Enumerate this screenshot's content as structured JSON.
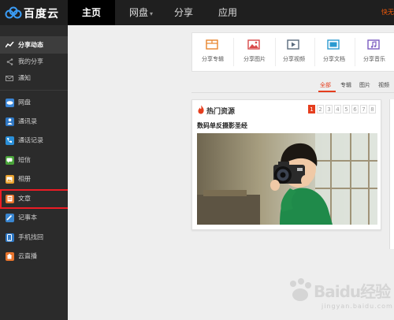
{
  "app": {
    "logo_text": "百度云"
  },
  "top_nav": {
    "items": [
      {
        "label": "主页",
        "active": true
      },
      {
        "label": "网盘"
      },
      {
        "label": "分享"
      },
      {
        "label": "应用"
      }
    ],
    "right_text": "快无"
  },
  "sidebar": {
    "items": [
      {
        "label": "分享动态",
        "icon": "activity-icon",
        "active": true
      },
      {
        "label": "我的分享",
        "icon": "share-icon"
      },
      {
        "label": "通知",
        "icon": "mail-icon"
      },
      {
        "label": "网盘",
        "icon": "cloud-drive-icon"
      },
      {
        "label": "通讯录",
        "icon": "contacts-icon"
      },
      {
        "label": "通话记录",
        "icon": "call-log-icon"
      },
      {
        "label": "短信",
        "icon": "sms-icon"
      },
      {
        "label": "相册",
        "icon": "album-icon"
      },
      {
        "label": "文章",
        "icon": "article-icon"
      },
      {
        "label": "记事本",
        "icon": "notepad-icon"
      },
      {
        "label": "手机找回",
        "icon": "find-phone-icon"
      },
      {
        "label": "云直播",
        "icon": "live-icon"
      }
    ]
  },
  "quick_share": {
    "items": [
      {
        "label": "分享专辑",
        "icon": "album-share-icon"
      },
      {
        "label": "分享图片",
        "icon": "image-share-icon"
      },
      {
        "label": "分享视频",
        "icon": "video-share-icon"
      },
      {
        "label": "分享文档",
        "icon": "doc-share-icon"
      },
      {
        "label": "分享音乐",
        "icon": "music-share-icon"
      }
    ]
  },
  "filters": {
    "items": [
      {
        "label": "全部",
        "active": true
      },
      {
        "label": "专辑"
      },
      {
        "label": "图片"
      },
      {
        "label": "视频"
      }
    ]
  },
  "hot_card": {
    "title": "热门资源",
    "subtitle": "数码单反摄影圣经",
    "pages": [
      "1",
      "2",
      "3",
      "4",
      "5",
      "6",
      "7",
      "8"
    ],
    "current_page": 1
  },
  "watermark": {
    "text": "Baidu经验",
    "sub": "jingyan.baidu.com"
  },
  "colors": {
    "accent": "#e53e1e",
    "highlight": "#ec1c24",
    "topbar": "#1f1f1f",
    "sidebar": "#2b2b2b"
  }
}
